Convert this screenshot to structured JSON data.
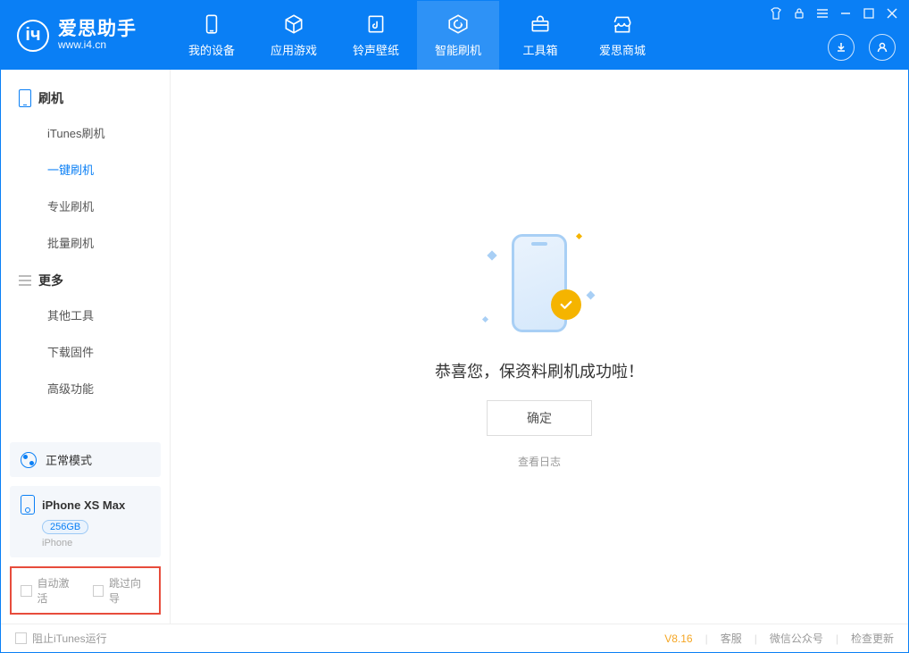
{
  "app": {
    "name_cn": "爱思助手",
    "name_en": "www.i4.cn"
  },
  "tabs": [
    {
      "label": "我的设备",
      "icon": "device-icon"
    },
    {
      "label": "应用游戏",
      "icon": "cube-icon"
    },
    {
      "label": "铃声壁纸",
      "icon": "music-icon"
    },
    {
      "label": "智能刷机",
      "icon": "refresh-icon"
    },
    {
      "label": "工具箱",
      "icon": "toolbox-icon"
    },
    {
      "label": "爱思商城",
      "icon": "store-icon"
    }
  ],
  "active_tab_index": 3,
  "sidebar": {
    "section1": {
      "title": "刷机",
      "items": [
        "iTunes刷机",
        "一键刷机",
        "专业刷机",
        "批量刷机"
      ],
      "active_index": 1
    },
    "section2": {
      "title": "更多",
      "items": [
        "其他工具",
        "下载固件",
        "高级功能"
      ]
    },
    "mode": "正常模式",
    "device": {
      "name": "iPhone XS Max",
      "capacity": "256GB",
      "subtype": "iPhone"
    },
    "checks": {
      "auto_activate": "自动激活",
      "skip_wizard": "跳过向导"
    }
  },
  "main": {
    "success_text": "恭喜您，保资料刷机成功啦！",
    "ok_button": "确定",
    "view_log": "查看日志"
  },
  "footer": {
    "block_itunes": "阻止iTunes运行",
    "version": "V8.16",
    "links": [
      "客服",
      "微信公众号",
      "检查更新"
    ]
  }
}
